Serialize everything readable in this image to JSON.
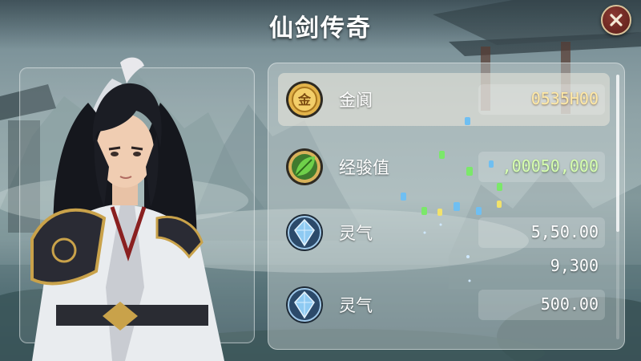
{
  "header": {
    "title": "仙剑传奇",
    "close_icon": "close-icon"
  },
  "character": {
    "name_icon": "hero-portrait"
  },
  "stats": [
    {
      "icon": "gold-coin-icon",
      "coin_char": "金",
      "label": "金阆",
      "value": "0535H00",
      "highlight": true,
      "value_color": "#ffe9a6"
    },
    {
      "icon": "leaf-icon",
      "label": "经骏值",
      "value": ",00050,000",
      "highlight": false,
      "value_color": "#d8ffb0"
    },
    {
      "icon": "crystal-icon",
      "label": "灵气",
      "value": "5,50.00",
      "value2": "9,300",
      "highlight": false,
      "value_color": "#ffffff"
    },
    {
      "icon": "crystal-icon",
      "label": "灵气",
      "value": "500.00",
      "highlight": false,
      "value_color": "#ffffff"
    }
  ],
  "colors": {
    "accent_gold": "#d9b45a",
    "close_red": "#7a2a22",
    "leaf_green": "#4caf3a",
    "crystal_blue": "#5aa8e8"
  }
}
